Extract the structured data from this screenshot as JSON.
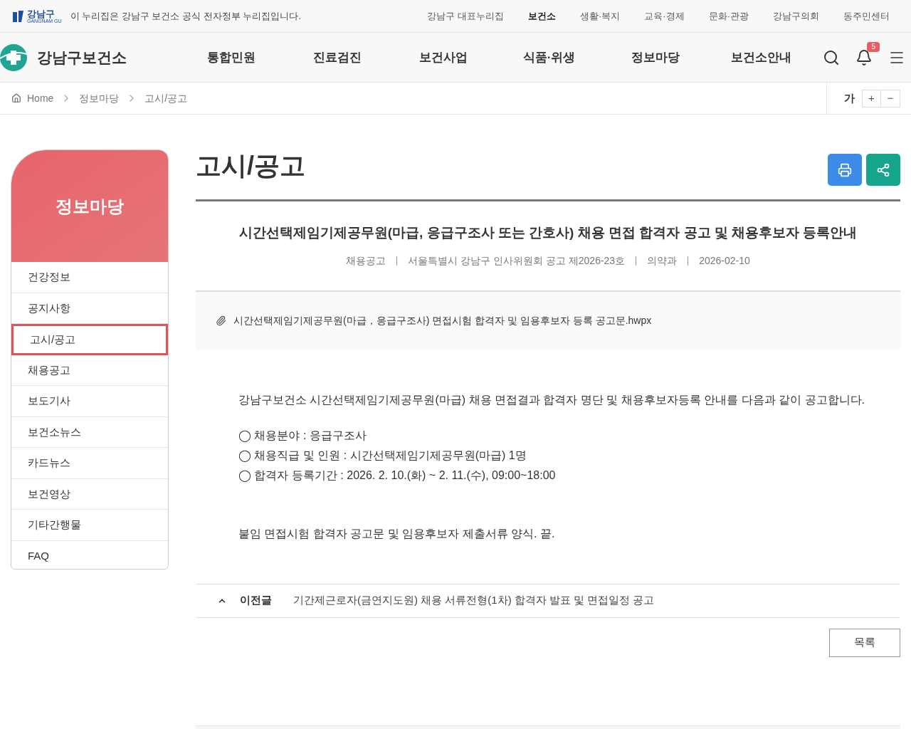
{
  "utility_bar": {
    "logo_text": "강남구",
    "logo_subtext": "GANGNAM GU",
    "notice": "이 누리집은 강남구 보건소 공식 전자정부 누리집입니다.",
    "links": [
      {
        "label": "강남구 대표누리집",
        "selected": false
      },
      {
        "label": "보건소",
        "selected": true
      },
      {
        "label": "생활·복지",
        "selected": false
      },
      {
        "label": "교육·경제",
        "selected": false
      },
      {
        "label": "문화·관광",
        "selected": false
      },
      {
        "label": "강남구의회",
        "selected": false
      },
      {
        "label": "동주민센터",
        "selected": false
      }
    ]
  },
  "header": {
    "site_name": "강남구보건소",
    "nav": [
      "통합민원",
      "진료검진",
      "보건사업",
      "식품·위생",
      "정보마당",
      "보건소안내"
    ],
    "notification_count": "5"
  },
  "breadcrumb": {
    "items": [
      "Home",
      "정보마당",
      "고시/공고"
    ],
    "font_size_label": "가",
    "font_increase": "+",
    "font_decrease": "−"
  },
  "sidebar": {
    "title": "정보마당",
    "items": [
      {
        "label": "건강정보",
        "selected": false
      },
      {
        "label": "공지사항",
        "selected": false
      },
      {
        "label": "고시/공고",
        "selected": true
      },
      {
        "label": "채용공고",
        "selected": false
      },
      {
        "label": "보도기사",
        "selected": false
      },
      {
        "label": "보건소뉴스",
        "selected": false
      },
      {
        "label": "카드뉴스",
        "selected": false
      },
      {
        "label": "보건영상",
        "selected": false
      },
      {
        "label": "기타간행물",
        "selected": false
      },
      {
        "label": "FAQ",
        "selected": false
      }
    ]
  },
  "page_title": "고시/공고",
  "post": {
    "title": "시간선택제임기제공무원(마급, 응급구조사 또는 간호사) 채용 면접 합격자 공고 및 채용후보자 등록안내",
    "meta": [
      "채용공고",
      "서울특별시 강남구 인사위원회 공고 제2026-23호",
      "의약과",
      "2026-02-10"
    ],
    "attachment": "시간선택제임기제공무원(마급，응급구조사) 면접시험 합격자 및 임용후보자 등록 공고문.hwpx",
    "intro": "강남구보건소 시간선택제임기제공무원(마급) 채용 면접결과 합격자 명단 및 채용후보자등록 안내를 다음과 같이 공고합니다.",
    "items": [
      "◯ 채용분야 : 응급구조사",
      "◯ 채용직급 및 인원 : 시간선택제임기제공무원(마급) 1명",
      "◯ 합격자 등록기간 : 2026. 2. 10.(화) ~ 2. 11.(수), 09:00~18:00"
    ],
    "closing": "붙임 면접시험 합격자 공고문 및 임용후보자 제출서류 양식. 끝."
  },
  "previous_post": {
    "label": "이전글",
    "title": "기간제근로자(금연지도원) 채용 서류전형(1차) 합격자 발표 및 면접일정 공고"
  },
  "list_button": "목록"
}
